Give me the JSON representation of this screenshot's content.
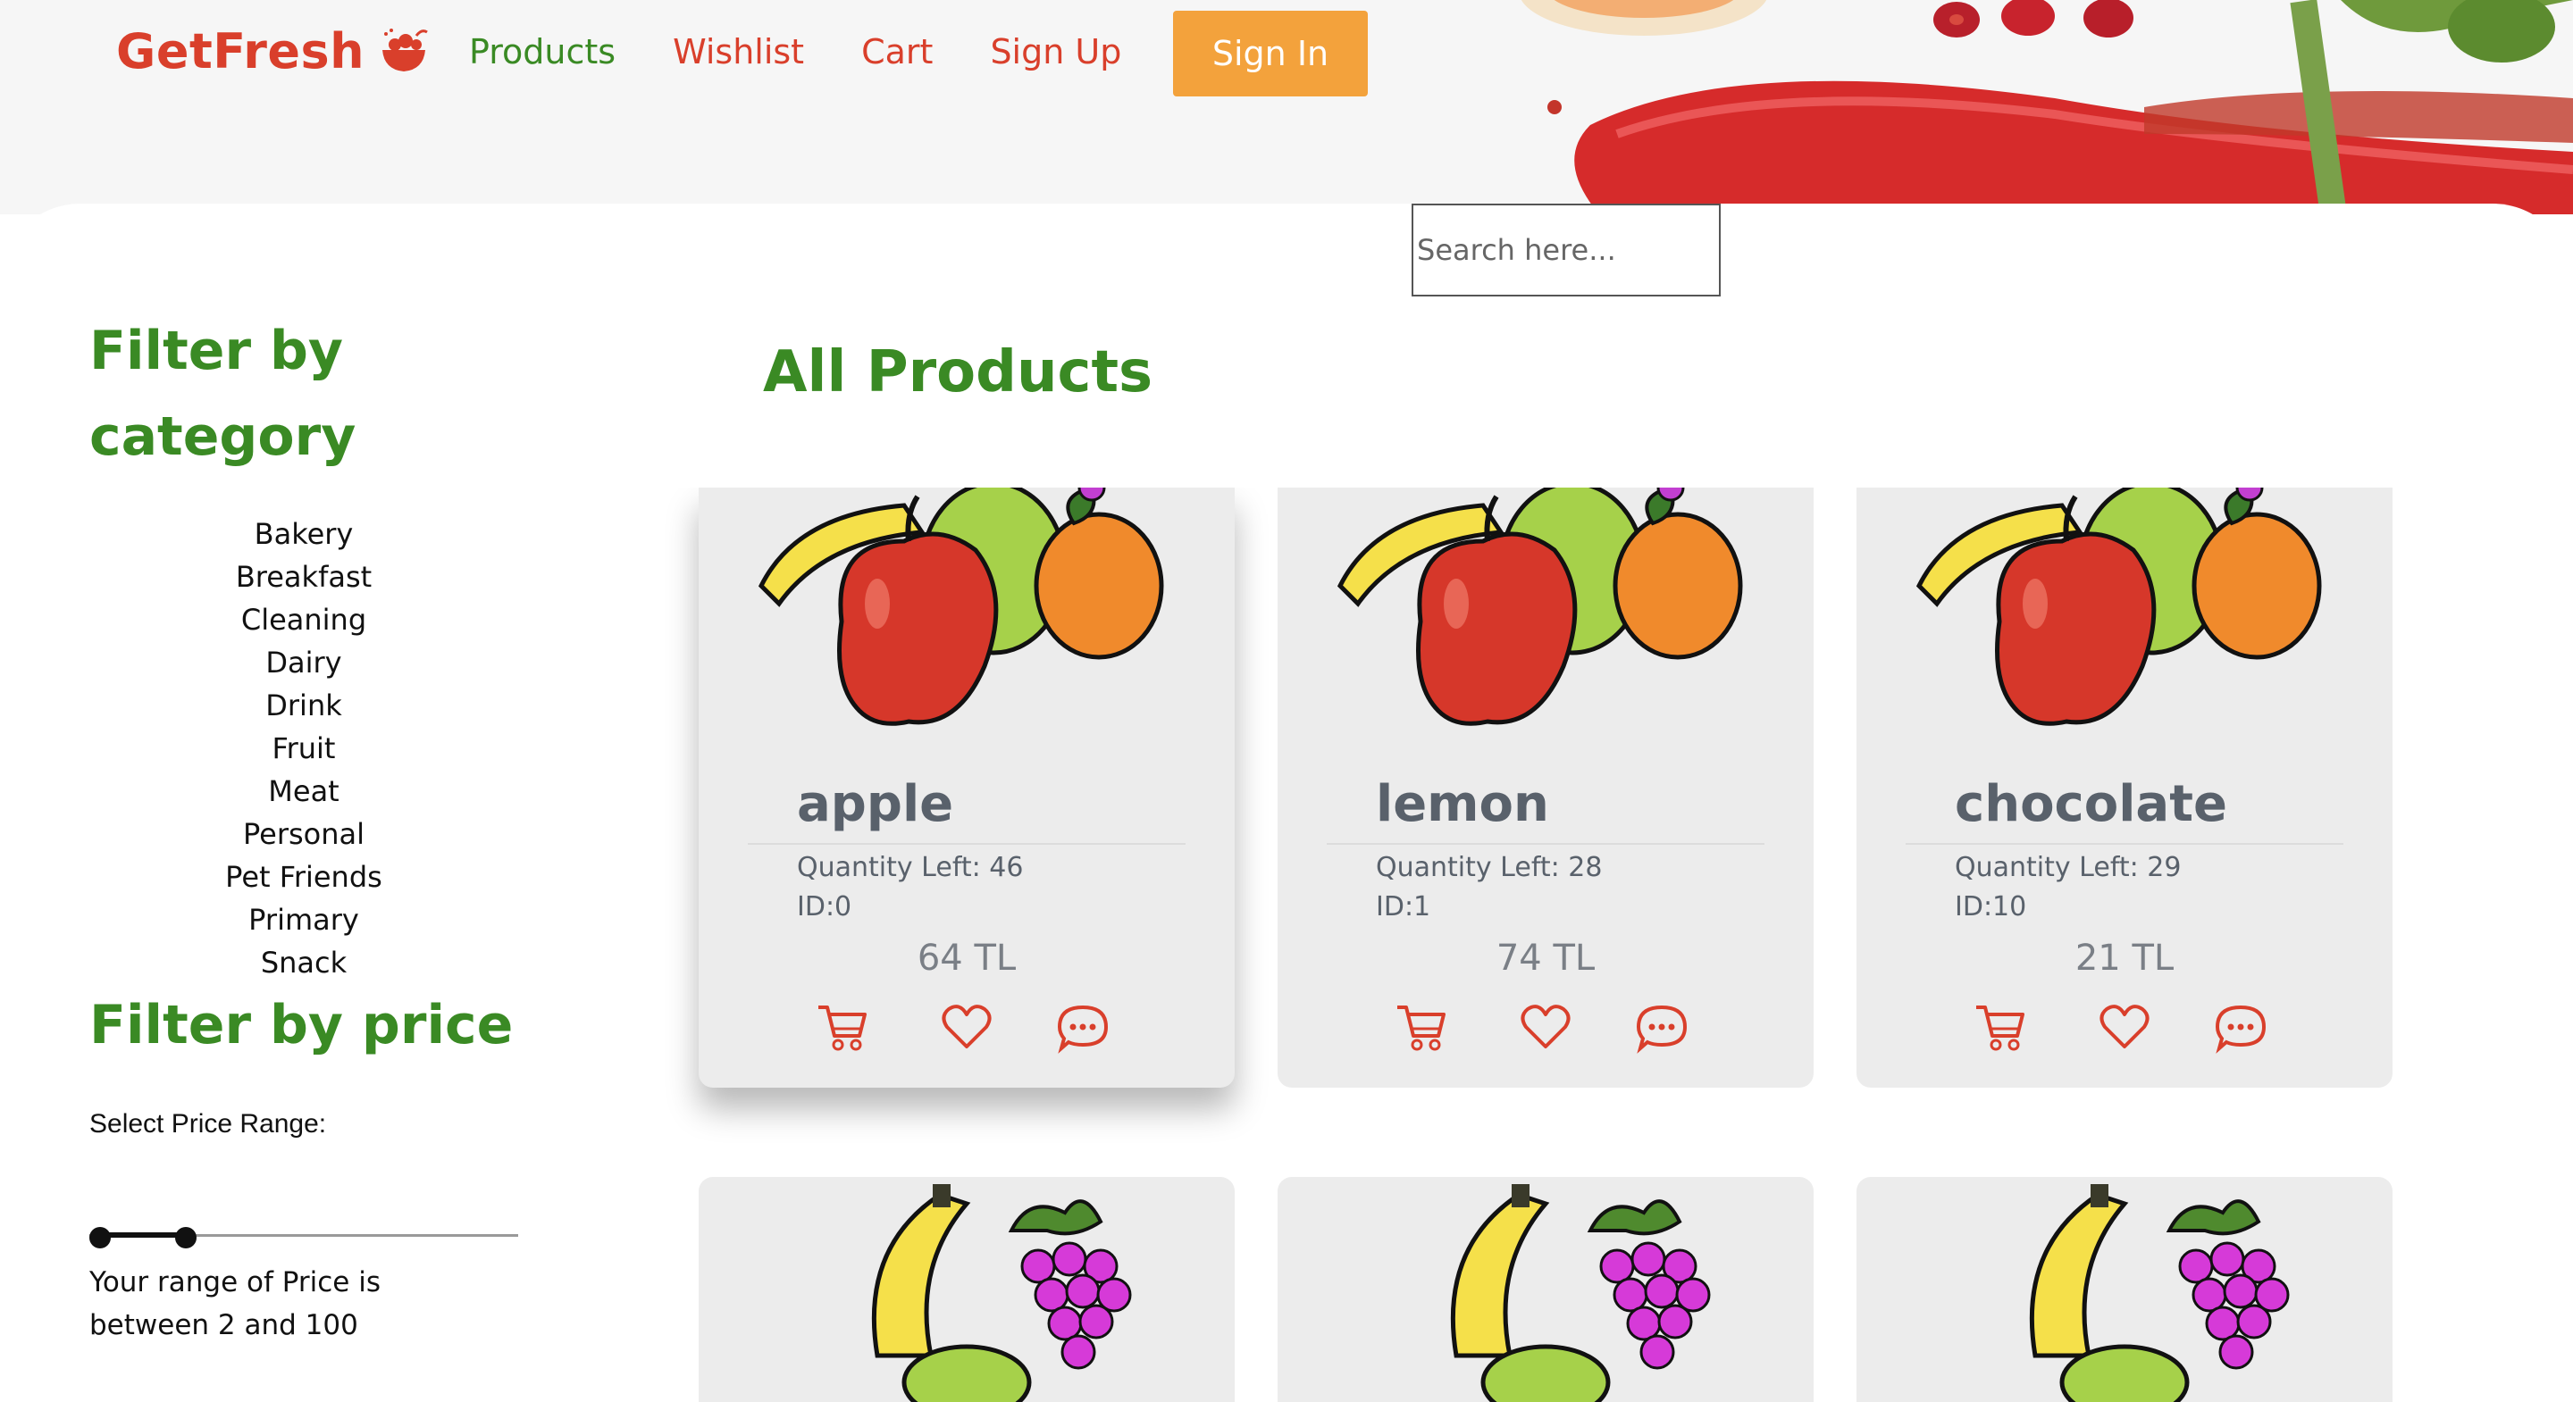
{
  "brand": {
    "name": "GetFresh",
    "color": "#d93f2b",
    "icon": "fruit-bowl-icon"
  },
  "nav": {
    "items": [
      {
        "label": "Products",
        "active": true
      },
      {
        "label": "Wishlist",
        "active": false
      },
      {
        "label": "Cart",
        "active": false
      },
      {
        "label": "Sign Up",
        "active": false
      }
    ],
    "signin_label": "Sign In"
  },
  "search": {
    "placeholder": "Search here..."
  },
  "sidebar": {
    "category_title": "Filter by category",
    "categories": [
      "Bakery",
      "Breakfast",
      "Cleaning",
      "Dairy",
      "Drink",
      "Fruit",
      "Meat",
      "Personal",
      "Pet Friends",
      "Primary",
      "Snack"
    ],
    "price_title": "Filter by price",
    "price_label": "Select Price Range:",
    "price_range": {
      "min": 2,
      "max": 100
    },
    "range_text": "Your range of Price is between 2 and 100"
  },
  "main": {
    "title": "All Products",
    "products": [
      {
        "name": "apple",
        "quantity": "Quantity Left: 46",
        "id": "ID:0",
        "price": "64 TL",
        "image": "mixed-fruit-illustration"
      },
      {
        "name": "lemon",
        "quantity": "Quantity Left: 28",
        "id": "ID:1",
        "price": "74 TL",
        "image": "mixed-fruit-illustration"
      },
      {
        "name": "chocolate",
        "quantity": "Quantity Left: 29",
        "id": "ID:10",
        "price": "21 TL",
        "image": "mixed-fruit-illustration"
      }
    ],
    "products_row2": [
      {
        "image": "banana-grapes-illustration"
      },
      {
        "image": "banana-grapes-illustration"
      },
      {
        "image": "banana-grapes-illustration"
      }
    ],
    "action_icons": [
      "cart-icon",
      "heart-icon",
      "comment-icon"
    ]
  },
  "colors": {
    "accent_green": "#3a8a24",
    "accent_red": "#d93f2b",
    "signin_orange": "#f3a23c",
    "card_bg": "#ececec"
  }
}
